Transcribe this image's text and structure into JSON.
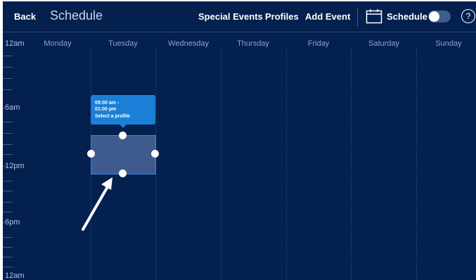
{
  "header": {
    "back_label": "Back",
    "title": "Schedule",
    "nav": [
      "Special Events",
      "Profiles",
      "Add Event"
    ],
    "schedule_label": "Schedule",
    "help_symbol": "?",
    "calendar_icon": "calendar-icon",
    "toggle_on": false
  },
  "days": [
    "Monday",
    "Tuesday",
    "Wednesday",
    "Thursday",
    "Friday",
    "Saturday",
    "Sunday"
  ],
  "time_labels": [
    "12am",
    "6am",
    "12pm",
    "6pm",
    "12am"
  ],
  "event": {
    "time_range": "09:00 am - 01:00 pm",
    "time_line1": "09:00 am -",
    "time_line2": "01:00 pm",
    "profile_prompt": "Select a profile"
  },
  "colors": {
    "background": "#03204f",
    "tooltip": "#1a7fd6",
    "event_block": "#3f5a8e",
    "accent_border": "#2f88e0"
  }
}
